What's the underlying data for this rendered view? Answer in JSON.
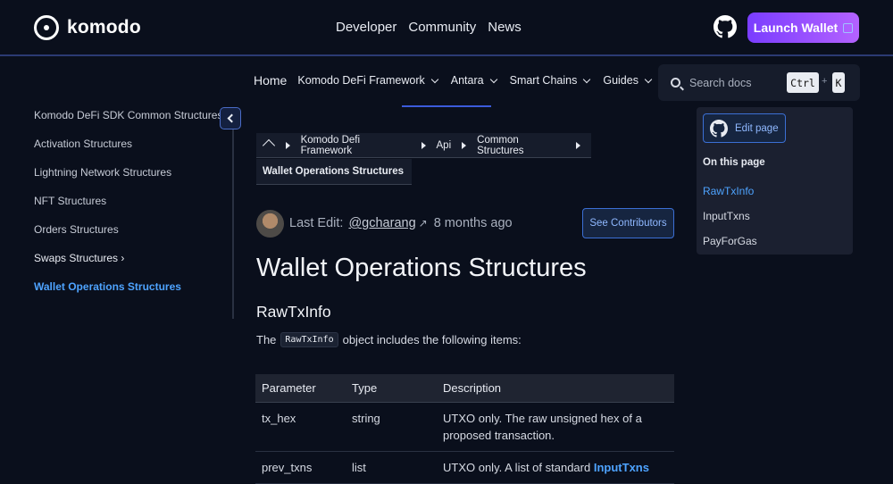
{
  "brand": {
    "name": "komodo"
  },
  "topnav": {
    "links": [
      "Developer",
      "Community",
      "News"
    ],
    "launch_label": "Launch Wallet"
  },
  "subnav": {
    "home": "Home",
    "items": [
      "Komodo DeFi Framework",
      "Antara",
      "Smart Chains",
      "Guides"
    ]
  },
  "search": {
    "placeholder": "Search docs",
    "key1": "Ctrl",
    "plus": "+",
    "key2": "K"
  },
  "sidebar": {
    "items": [
      "Komodo DeFi SDK Common Structures",
      "Activation Structures",
      "Lightning Network Structures",
      "NFT Structures",
      "Orders Structures",
      "Swaps Structures",
      "Wallet Operations Structures"
    ]
  },
  "breadcrumb": {
    "items": [
      "Komodo Defi Framework",
      "Api",
      "Common Structures"
    ],
    "current": "Wallet Operations Structures"
  },
  "lastedit": {
    "label": "Last Edit:",
    "user": "@gcharang",
    "arrow": "↗",
    "ago": "8 months ago",
    "contributors_label": "See Contributors"
  },
  "main": {
    "title": "Wallet Operations Structures",
    "section": "RawTxInfo",
    "para_before": "The",
    "para_code": "RawTxInfo",
    "para_after": "object includes the following items:"
  },
  "table": {
    "headers": [
      "Parameter",
      "Type",
      "Description"
    ],
    "rows": [
      {
        "param": "tx_hex",
        "type": "string",
        "desc": "UTXO only. The raw unsigned hex of a proposed transaction."
      },
      {
        "param": "prev_txns",
        "type": "list",
        "desc": "UTXO only. A list of standard",
        "link": "InputTxns"
      }
    ]
  },
  "rightpanel": {
    "edit_label": "Edit page",
    "onpage_title": "On this page",
    "toc": [
      "RawTxInfo",
      "InputTxns",
      "PayForGas"
    ]
  },
  "colors": {
    "background": "#0a0f1c",
    "accent": "#4ea3ff",
    "launch_gradient_start": "#7a3dff",
    "launch_gradient_end": "#b462ff"
  }
}
